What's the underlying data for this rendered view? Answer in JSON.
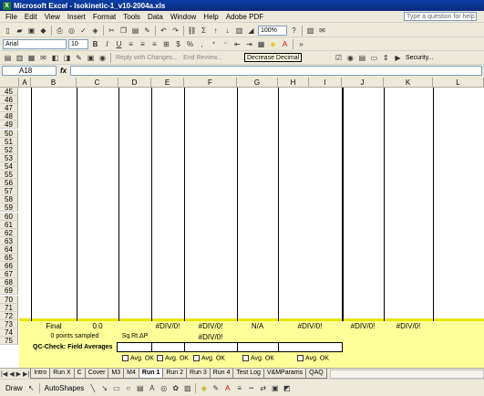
{
  "window": {
    "title": "Microsoft Excel - Isokinetic-1_v10-2004a.xls"
  },
  "menu": [
    "File",
    "Edit",
    "View",
    "Insert",
    "Format",
    "Tools",
    "Data",
    "Window",
    "Help",
    "Adobe PDF"
  ],
  "help_placeholder": "Type a question for help",
  "toolbar": {
    "zoom": "100%",
    "font": "Arial",
    "size": "10",
    "reply_changes": "Reply with Changes...",
    "end_review": "End Review...",
    "security": "Security..."
  },
  "tooltip": "Decrease Decimal",
  "formula": {
    "cell_ref": "A18",
    "fx": "fx",
    "content": ""
  },
  "columns": [
    "A",
    "B",
    "C",
    "D",
    "E",
    "F",
    "G",
    "H",
    "I",
    "J",
    "K",
    "L"
  ],
  "rows": [
    "45",
    "46",
    "47",
    "48",
    "49",
    "50",
    "51",
    "52",
    "53",
    "54",
    "55",
    "56",
    "57",
    "58",
    "59",
    "60",
    "61",
    "62",
    "63",
    "64",
    "65",
    "66",
    "67",
    "68",
    "69",
    "70",
    "71",
    "72",
    "73",
    "74",
    "75"
  ],
  "row71": {
    "label": "Final",
    "c": "0.0",
    "e": "#DIV/0!",
    "f": "#DIV/0!",
    "g": "N/A",
    "hi": "#DIV/0!",
    "j": "#DIV/0!",
    "k": "#DIV/0!"
  },
  "row72": {
    "b": "0 points sampled",
    "d": "Sq.Rt.ΔP",
    "f": "#DIV/0!"
  },
  "row73": {
    "label": "QC-Check: Field Averages"
  },
  "row74": {
    "avg1": "Avg. OK",
    "avg2": "Avg. OK",
    "avg3": "Avg. OK",
    "avg4": "Avg. OK",
    "avg5": "Avg. OK"
  },
  "tabs": [
    "Intro",
    "Run X",
    "C",
    "Cover",
    "M3",
    "M4",
    "Run 1",
    "Run 2",
    "Run 3",
    "Run 4",
    "Test Log",
    "V&MParams",
    "QAQ"
  ],
  "active_tab": "Run 1",
  "draw": {
    "draw_label": "Draw",
    "autoshapes_label": "AutoShapes"
  }
}
